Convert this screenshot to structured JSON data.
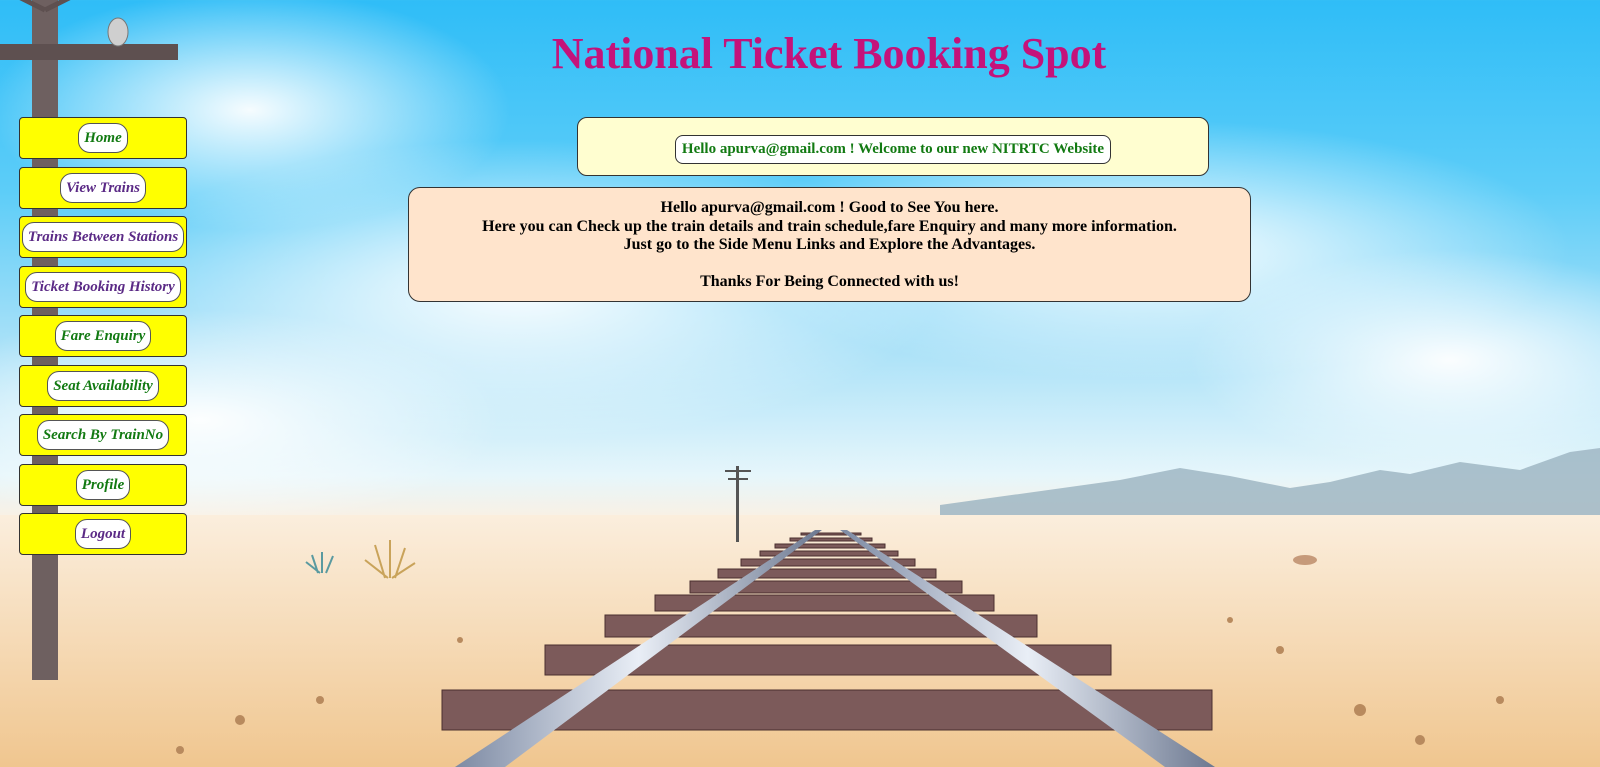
{
  "header": {
    "title": "National Ticket Booking Spot"
  },
  "colors": {
    "title": "#c4137a",
    "menu_bg": "#ffff00",
    "menu_link_green": "#127a12",
    "menu_link_purple": "#5b2a86",
    "welcome_box_bg": "#fffed0",
    "welcome_text": "#127a12",
    "info_box_bg": "#ffe4cc"
  },
  "sidebar": {
    "items": [
      {
        "label": "Home",
        "icon": "",
        "color": "#127a12"
      },
      {
        "label": "View Trains",
        "color": "#5b2a86"
      },
      {
        "label": "Trains Between Stations",
        "color": "#5b2a86"
      },
      {
        "label": "Ticket Booking History",
        "color": "#5b2a86"
      },
      {
        "label": "Fare Enquiry",
        "color": "#127a12"
      },
      {
        "label": "Seat Availability",
        "color": "#127a12"
      },
      {
        "label": "Search By TrainNo",
        "color": "#127a12"
      },
      {
        "label": "Profile",
        "color": "#127a12"
      },
      {
        "label": "Logout",
        "color": "#5b2a86"
      }
    ]
  },
  "welcome": {
    "text": "Hello apurva@gmail.com ! Welcome to our new NITRTC Website"
  },
  "info": {
    "line1": "Hello apurva@gmail.com ! Good to See You here.",
    "line2": "Here you can Check up the train details and train schedule,fare Enquiry and many more information.",
    "line3": "Just go to the Side Menu Links and Explore the Advantages.",
    "line4": "Thanks For Being Connected with us!"
  }
}
